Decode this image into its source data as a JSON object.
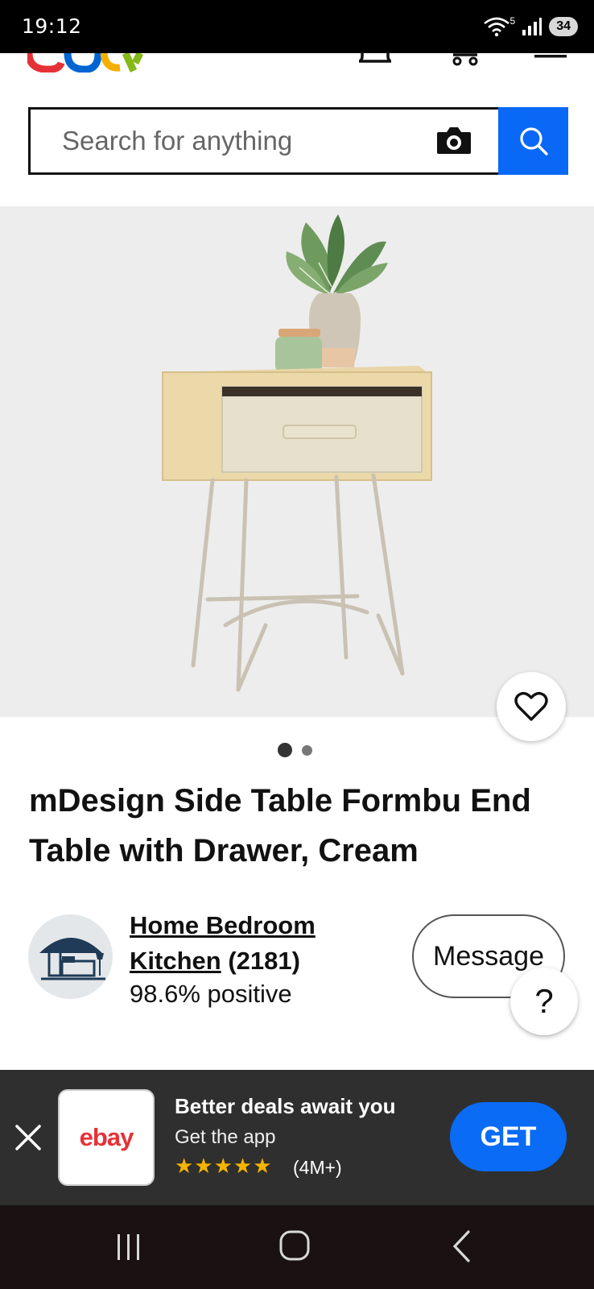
{
  "status_bar": {
    "time": "19:12",
    "battery": "34",
    "network": "5"
  },
  "header": {
    "logo_text": "ebay",
    "search": {
      "placeholder": "Search for anything"
    }
  },
  "gallery": {
    "image_count": 2,
    "active_index": 0
  },
  "product": {
    "title": "mDesign Side Table Formbu End Table with Drawer, Cream"
  },
  "seller": {
    "name_line1": "Home Bedroom",
    "name_line2": "Kitchen",
    "feedback_count": "(2181)",
    "positive": "98.6% positive",
    "message_label": "Message"
  },
  "help_label": "?",
  "app_banner": {
    "title": "Better deals await you",
    "subtitle": "Get the app",
    "stars": "★★★★★",
    "rating_count": "(4M+)",
    "get_label": "GET",
    "logo_text": "ebay"
  },
  "colors": {
    "accent": "#0968f6",
    "banner_bg": "#2f2f2f",
    "star": "#f5b400"
  }
}
